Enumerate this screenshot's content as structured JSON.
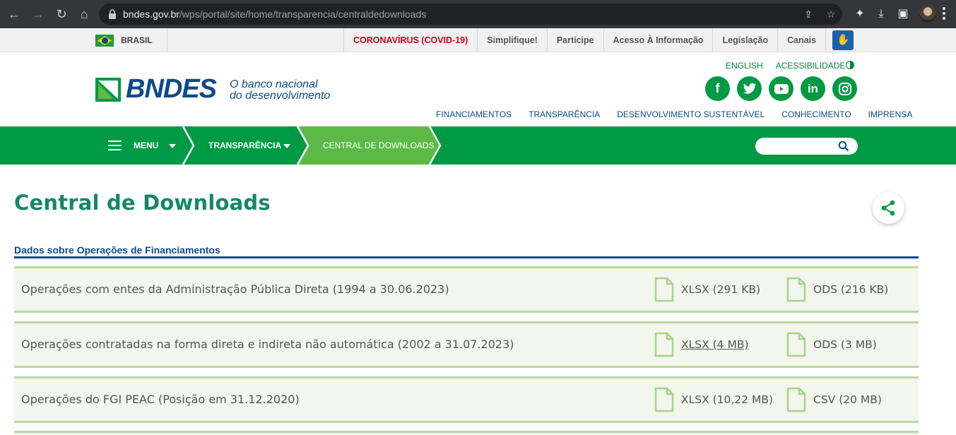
{
  "browser": {
    "url_host": "bndes.gov.br",
    "url_path": "/wps/portal/site/home/transparencia/centraldedownloads"
  },
  "govbar": {
    "brasil": "BRASIL",
    "links": [
      "CORONAVÍRUS (COVID-19)",
      "Simplifique!",
      "Participe",
      "Acesso À Informação",
      "Legislação",
      "Canais"
    ]
  },
  "header": {
    "logo": "BNDES",
    "tagline_1": "O banco nacional",
    "tagline_2": "do desenvolvimento",
    "lang_english": "ENGLISH",
    "accessibility": "ACESSIBILIDADE",
    "socials": [
      "facebook-icon",
      "twitter-icon",
      "youtube-icon",
      "linkedin-icon",
      "instagram-icon"
    ],
    "main_links": [
      "FINANCIAMENTOS",
      "TRANSPARÊNCIA",
      "DESENVOLVIMENTO SUSTENTÁVEL",
      "CONHECIMENTO",
      "IMPRENSA"
    ]
  },
  "greennav": {
    "menu": "MENU",
    "crumb_1": "TRANSPARÊNCIA",
    "crumb_2": "CENTRAL DE DOWNLOADS",
    "search_placeholder": ""
  },
  "content": {
    "title": "Central de Downloads",
    "section": "Dados sobre Operações de Financiamentos",
    "rows": [
      {
        "label": "Operações com entes da Administração Pública Direta (1994 a 30.06.2023)",
        "file1": "XLSX (291 KB)",
        "file2": "ODS (216 KB)"
      },
      {
        "label": "Operações contratadas na forma direta e indireta não automática (2002 a 31.07.2023)",
        "file1": "XLSX (4 MB)",
        "file2": "ODS (3 MB)"
      },
      {
        "label": "Operações do FGI PEAC (Posição em 31.12.2020)",
        "file1": "XLSX (10,22 MB)",
        "file2": "CSV (20 MB)"
      }
    ]
  },
  "colors": {
    "brand_green": "#009a44",
    "active_green": "#5cb946",
    "brand_blue": "#0e4a8a",
    "title_teal": "#13886a",
    "covid_red": "#d0021b"
  }
}
